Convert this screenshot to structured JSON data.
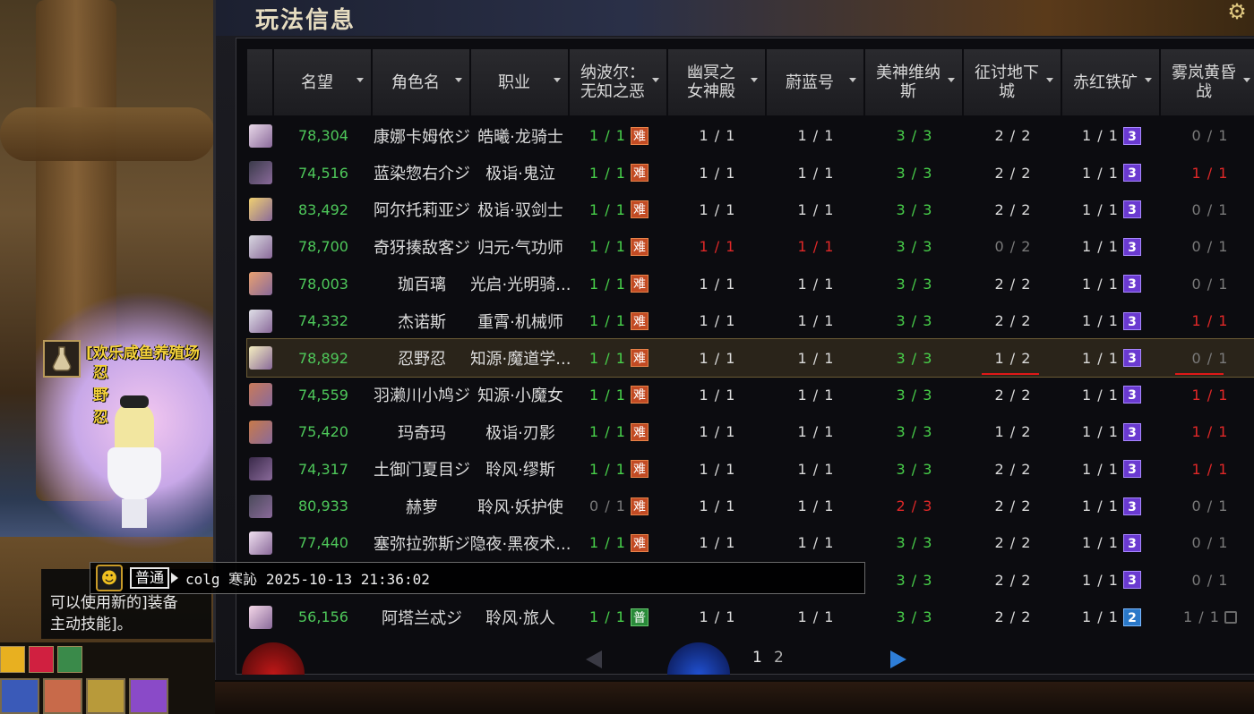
{
  "panel": {
    "title": "玩法信息"
  },
  "columns": [
    "名望",
    "角色名",
    "职业",
    "纳波尔：\n无知之恶",
    "幽冥之\n女神殿",
    "蔚蓝号",
    "美神维纳\n斯",
    "征讨地下\n城",
    "赤红铁矿",
    "雾岚黄昏\n战"
  ],
  "rows": [
    {
      "fame": "78,304",
      "name": "康娜卡姆依ジ",
      "job": "皓曦·龙骑士",
      "c1": "1 / 1",
      "c1b": "难",
      "c2": "1 / 1",
      "c3": "1 / 1",
      "c4": "3 / 3",
      "c5": "2 / 2",
      "c6": "1 / 1",
      "c6b": "3",
      "c7": "0 / 1",
      "st": [
        "g",
        "w",
        "w",
        "g",
        "w",
        "w",
        "d"
      ]
    },
    {
      "fame": "74,516",
      "name": "蓝染惣右介ジ",
      "job": "极诣·鬼泣",
      "c1": "1 / 1",
      "c1b": "难",
      "c2": "1 / 1",
      "c3": "1 / 1",
      "c4": "3 / 3",
      "c5": "2 / 2",
      "c6": "1 / 1",
      "c6b": "3",
      "c7": "1 / 1",
      "st": [
        "g",
        "w",
        "w",
        "g",
        "w",
        "w",
        "r"
      ]
    },
    {
      "fame": "83,492",
      "name": "阿尔托莉亚ジ",
      "job": "极诣·驭剑士",
      "c1": "1 / 1",
      "c1b": "难",
      "c2": "1 / 1",
      "c3": "1 / 1",
      "c4": "3 / 3",
      "c5": "2 / 2",
      "c6": "1 / 1",
      "c6b": "3",
      "c7": "0 / 1",
      "st": [
        "g",
        "w",
        "w",
        "g",
        "w",
        "w",
        "d"
      ]
    },
    {
      "fame": "78,700",
      "name": "奇犽揍敌客ジ",
      "job": "归元·气功师",
      "c1": "1 / 1",
      "c1b": "难",
      "c2": "1 / 1",
      "c3": "1 / 1",
      "c4": "3 / 3",
      "c5": "0 / 2",
      "c6": "1 / 1",
      "c6b": "3",
      "c7": "0 / 1",
      "st": [
        "g",
        "r",
        "r",
        "g",
        "d",
        "w",
        "d"
      ]
    },
    {
      "fame": "78,003",
      "name": "珈百璃",
      "job": "光启·光明骑...",
      "c1": "1 / 1",
      "c1b": "难",
      "c2": "1 / 1",
      "c3": "1 / 1",
      "c4": "3 / 3",
      "c5": "2 / 2",
      "c6": "1 / 1",
      "c6b": "3",
      "c7": "0 / 1",
      "st": [
        "g",
        "w",
        "w",
        "g",
        "w",
        "w",
        "d"
      ]
    },
    {
      "fame": "74,332",
      "name": "杰诺斯",
      "job": "重霄·机械师",
      "c1": "1 / 1",
      "c1b": "难",
      "c2": "1 / 1",
      "c3": "1 / 1",
      "c4": "3 / 3",
      "c5": "2 / 2",
      "c6": "1 / 1",
      "c6b": "3",
      "c7": "1 / 1",
      "st": [
        "g",
        "w",
        "w",
        "g",
        "w",
        "w",
        "r"
      ]
    },
    {
      "fame": "78,892",
      "name": "忍野忍",
      "job": "知源·魔道学...",
      "c1": "1 / 1",
      "c1b": "难",
      "c2": "1 / 1",
      "c3": "1 / 1",
      "c4": "3 / 3",
      "c5": "1 / 2",
      "c6": "1 / 1",
      "c6b": "3",
      "c7": "0 / 1",
      "st": [
        "g",
        "w",
        "w",
        "g",
        "w",
        "w",
        "d"
      ],
      "selected": true
    },
    {
      "fame": "74,559",
      "name": "羽濑川小鸠ジ",
      "job": "知源·小魔女",
      "c1": "1 / 1",
      "c1b": "难",
      "c2": "1 / 1",
      "c3": "1 / 1",
      "c4": "3 / 3",
      "c5": "2 / 2",
      "c6": "1 / 1",
      "c6b": "3",
      "c7": "1 / 1",
      "st": [
        "g",
        "w",
        "w",
        "g",
        "w",
        "w",
        "r"
      ]
    },
    {
      "fame": "75,420",
      "name": "玛奇玛",
      "job": "极诣·刃影",
      "c1": "1 / 1",
      "c1b": "难",
      "c2": "1 / 1",
      "c3": "1 / 1",
      "c4": "3 / 3",
      "c5": "1 / 2",
      "c6": "1 / 1",
      "c6b": "3",
      "c7": "1 / 1",
      "st": [
        "g",
        "w",
        "w",
        "g",
        "w",
        "w",
        "r"
      ]
    },
    {
      "fame": "74,317",
      "name": "土御门夏目ジ",
      "job": "聆风·缪斯",
      "c1": "1 / 1",
      "c1b": "难",
      "c2": "1 / 1",
      "c3": "1 / 1",
      "c4": "3 / 3",
      "c5": "2 / 2",
      "c6": "1 / 1",
      "c6b": "3",
      "c7": "1 / 1",
      "st": [
        "g",
        "w",
        "w",
        "g",
        "w",
        "w",
        "r"
      ]
    },
    {
      "fame": "80,933",
      "name": "赫萝",
      "job": "聆风·妖护使",
      "c1": "0 / 1",
      "c1b": "难",
      "c2": "1 / 1",
      "c3": "1 / 1",
      "c4": "2 / 3",
      "c5": "2 / 2",
      "c6": "1 / 1",
      "c6b": "3",
      "c7": "0 / 1",
      "st": [
        "d",
        "w",
        "w",
        "r",
        "w",
        "w",
        "d"
      ]
    },
    {
      "fame": "77,440",
      "name": "塞弥拉弥斯ジ",
      "job": "隐夜·黑夜术...",
      "c1": "1 / 1",
      "c1b": "难",
      "c2": "1 / 1",
      "c3": "1 / 1",
      "c4": "3 / 3",
      "c5": "2 / 2",
      "c6": "1 / 1",
      "c6b": "3",
      "c7": "0 / 1",
      "st": [
        "g",
        "w",
        "w",
        "g",
        "w",
        "w",
        "d"
      ]
    },
    {
      "fame": "",
      "name": "",
      "job": "",
      "c1": "",
      "c1b": "",
      "c2": "",
      "c3": "",
      "c4": "3 / 3",
      "c5": "2 / 2",
      "c6": "1 / 1",
      "c6b": "3",
      "c7": "0 / 1",
      "st": [
        "g",
        "w",
        "w",
        "g",
        "w",
        "w",
        "d"
      ]
    },
    {
      "fame": "56,156",
      "name": "阿塔兰忒ジ",
      "job": "聆风·旅人",
      "c1": "1 / 1",
      "c1b": "普",
      "c2": "1 / 1",
      "c3": "1 / 1",
      "c4": "3 / 3",
      "c5": "2 / 2",
      "c6": "1 / 1",
      "c6b": "2",
      "c7": "1 / 1",
      "st": [
        "g",
        "w",
        "w",
        "g",
        "w",
        "w",
        "d"
      ],
      "lock": true
    }
  ],
  "pager": {
    "page1": "1",
    "page2": "2"
  },
  "chat": {
    "channel": "普通",
    "text": "colg 寒訫 2025-10-13 21:36:02"
  },
  "tooltip": {
    "line1": "可以使用新的]装备",
    "line2": "主动技能]。"
  },
  "guild": {
    "name": "[欢乐咸鱼养殖场",
    "player": "忍野忍"
  },
  "colors": {
    "green": "#48d04a",
    "red": "#e02828",
    "hard_badge": "#c24b24",
    "normal_badge": "#2a8a3a",
    "purple_badge": "#6a3ad0",
    "blue_badge": "#2a78c8"
  }
}
